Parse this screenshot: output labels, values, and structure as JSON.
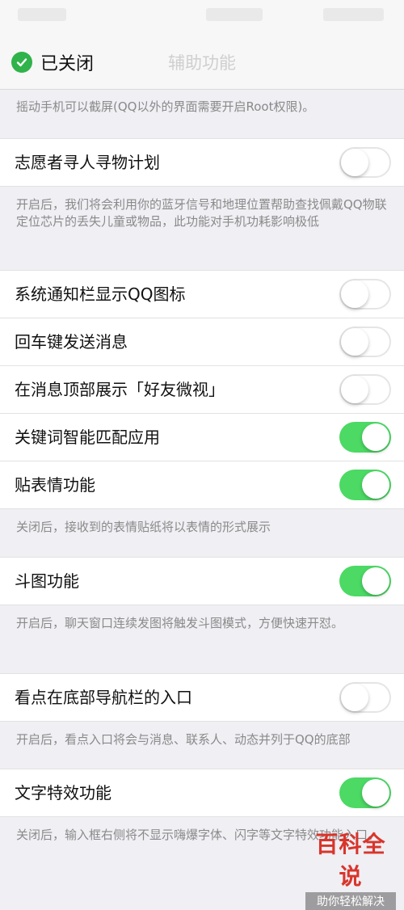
{
  "nav": {
    "title": "辅助功能"
  },
  "toast": {
    "label": "已关闭"
  },
  "top_note": "摇动手机可以截屏(QQ以外的界面需要开启Root权限)。",
  "settings": [
    {
      "label": "志愿者寻人寻物计划",
      "on": false
    },
    {
      "label": "开启后，我们将会利用你的蓝牙信号和地理位置帮助查找佩戴QQ物联定位芯片的丢失儿童或物品，此功能对手机功耗影响极低"
    },
    {
      "label": "系统通知栏显示QQ图标",
      "on": false
    },
    {
      "label": "回车键发送消息",
      "on": false
    },
    {
      "label": "在消息顶部展示「好友微视」",
      "on": false
    },
    {
      "label": "关键词智能匹配应用",
      "on": true
    },
    {
      "label": "贴表情功能",
      "on": true
    },
    {
      "label": "关闭后，接收到的表情贴纸将以表情的形式展示"
    },
    {
      "label": "斗图功能",
      "on": true
    },
    {
      "label": "开启后，聊天窗口连续发图将触发斗图模式，方便快速开怼。"
    },
    {
      "label": "看点在底部导航栏的入口",
      "on": false
    },
    {
      "label": "开启后，看点入口将会与消息、联系人、动态并列于QQ的底部"
    },
    {
      "label": "文字特效功能",
      "on": true
    },
    {
      "label": "关闭后，输入框右侧将不显示嗨爆字体、闪字等文字特效功能入口。"
    }
  ],
  "watermark": {
    "title": "百科全说",
    "subtitle": "助你轻松解决"
  },
  "colors": {
    "switch_on": "#4cd964",
    "check": "#2fb34a",
    "background": "#efeff4"
  }
}
